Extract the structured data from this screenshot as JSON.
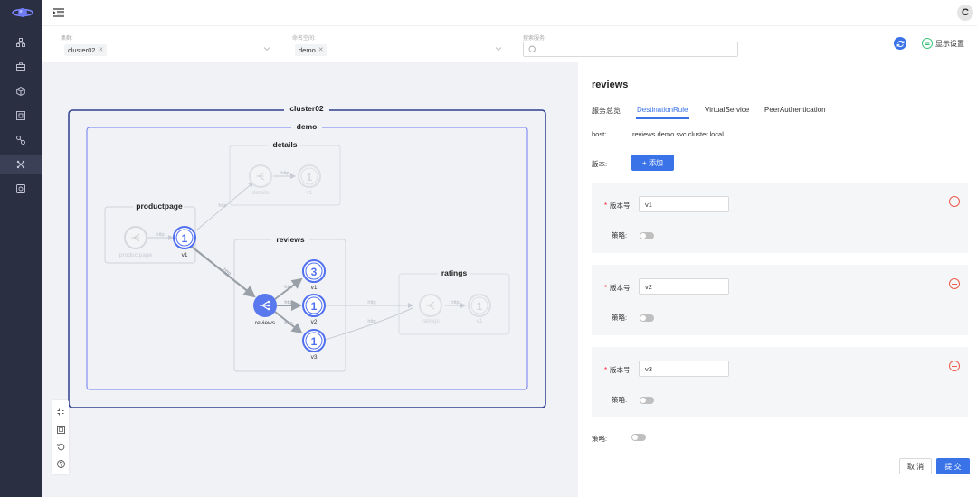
{
  "colors": {
    "accent": "#3a73e8",
    "sidebar": "#2b2f42",
    "danger": "#ef5a4c",
    "success": "#3cc27a"
  },
  "sidebar": {
    "logo_icon": "planet-logo-icon",
    "items": [
      {
        "icon": "topology-icon",
        "active": false
      },
      {
        "icon": "briefcase-icon",
        "active": false
      },
      {
        "icon": "cube-icon",
        "active": false
      },
      {
        "icon": "window-icon",
        "active": false
      },
      {
        "icon": "connection-icon",
        "active": false
      },
      {
        "icon": "mesh-icon",
        "active": true
      },
      {
        "icon": "grid-settings-icon",
        "active": false
      }
    ]
  },
  "header": {
    "avatar_letter": "C",
    "menu_icon": "menu-fold-icon"
  },
  "filters": {
    "cluster": {
      "label": "集群:",
      "tag": "cluster02"
    },
    "namespace": {
      "label": "命名空间:",
      "tag": "demo"
    },
    "search": {
      "label": "搜索服务:",
      "placeholder": ""
    },
    "display_settings": "显示设置"
  },
  "graph": {
    "cluster_label": "cluster02",
    "namespace_label": "demo",
    "groups": {
      "productpage": "productpage",
      "details": "details",
      "reviews": "reviews",
      "ratings": "ratings"
    },
    "nodes": {
      "productpage_service": "productpage",
      "productpage_v1_count": "1",
      "productpage_v1_label": "v1",
      "details_service": "details",
      "details_v1_count": "1",
      "details_v1_label": "v1",
      "reviews_service": "reviews",
      "reviews_v1_count": "3",
      "reviews_v1_label": "v1",
      "reviews_v2_count": "1",
      "reviews_v2_label": "v2",
      "reviews_v3_count": "1",
      "reviews_v3_label": "v3",
      "ratings_service": "ratings",
      "ratings_v1_count": "1",
      "ratings_v1_label": "v1"
    },
    "edge_label": "http",
    "controls": [
      "fit-screen-icon",
      "fullscreen-icon",
      "reset-icon",
      "help-icon"
    ]
  },
  "panel": {
    "title": "reviews",
    "tabs": [
      {
        "label": "服务总览",
        "active": false
      },
      {
        "label": "DestinationRule",
        "active": true
      },
      {
        "label": "VirtualService",
        "active": false
      },
      {
        "label": "PeerAuthentication",
        "active": false
      }
    ],
    "host_label": "host:",
    "host_value": "reviews.demo.svc.cluster.local",
    "version_label": "版本:",
    "add_label": "+ 添加",
    "versions": [
      {
        "label": "版本号:",
        "value": "v1",
        "policy_label": "策略:",
        "policy_on": false
      },
      {
        "label": "版本号:",
        "value": "v2",
        "policy_label": "策略:",
        "policy_on": false
      },
      {
        "label": "版本号:",
        "value": "v3",
        "policy_label": "策略:",
        "policy_on": false
      }
    ],
    "required_mark": "*",
    "policy_label": "策略:",
    "cancel_label": "取 消",
    "submit_label": "提 交"
  }
}
